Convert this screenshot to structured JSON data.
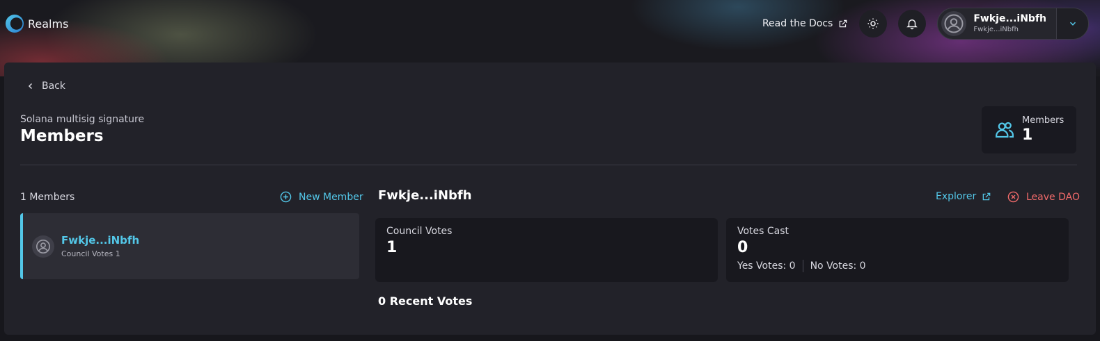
{
  "header": {
    "app_name": "Realms",
    "docs_label": "Read the Docs",
    "account": {
      "name": "Fwkje...iNbfh",
      "sub": "Fwkje...iNbfh"
    }
  },
  "page": {
    "back_label": "Back",
    "subtitle": "Solana multisig signature",
    "title": "Members",
    "members_stat": {
      "label": "Members",
      "value": "1"
    }
  },
  "members_list": {
    "count_label": "1 Members",
    "new_member_label": "New Member",
    "items": [
      {
        "name": "Fwkje...iNbfh",
        "votes": "Council Votes 1"
      }
    ]
  },
  "member_detail": {
    "name": "Fwkje...iNbfh",
    "explorer_label": "Explorer",
    "leave_label": "Leave DAO",
    "council_votes": {
      "label": "Council Votes",
      "value": "1"
    },
    "votes_cast": {
      "label": "Votes Cast",
      "value": "0",
      "yes": "Yes Votes: 0",
      "no": "No Votes: 0"
    },
    "recent_votes_label": "0 Recent Votes"
  },
  "colors": {
    "accent": "#53c7e8",
    "danger": "#f06a6a",
    "card": "#222229"
  }
}
